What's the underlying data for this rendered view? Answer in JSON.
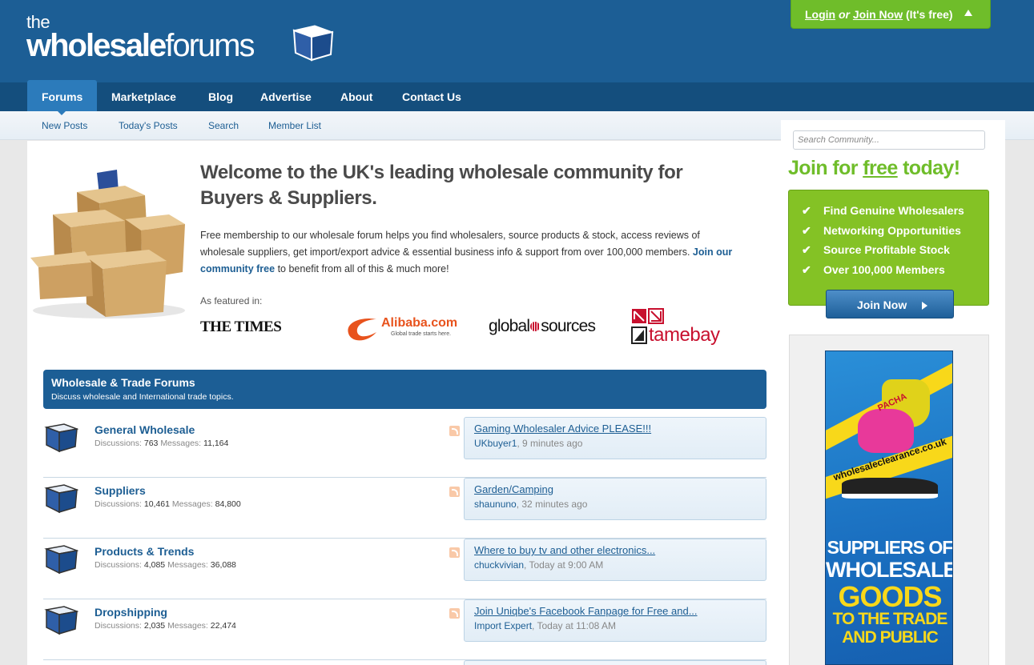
{
  "header": {
    "logo": {
      "the": "the",
      "bold": "wholesale",
      "light": "forums"
    },
    "login": {
      "login": "Login",
      "or": "or",
      "join": "Join Now",
      "free": "(It's free)"
    }
  },
  "nav": {
    "tabs": [
      {
        "label": "Forums",
        "active": true
      },
      {
        "label": "Marketplace"
      },
      {
        "label": "Blog"
      },
      {
        "label": "Advertise"
      },
      {
        "label": "About"
      },
      {
        "label": "Contact Us"
      }
    ],
    "subnav": [
      "New Posts",
      "Today's Posts",
      "Search",
      "Member List"
    ]
  },
  "search": {
    "placeholder": "Search Community..."
  },
  "welcome": {
    "heading": "Welcome to the UK's leading wholesale community for Buyers & Suppliers.",
    "intro": "Free membership to our wholesale forum helps you find wholesalers, source products & stock, access reviews of wholesale suppliers, get import/export advice & essential business info & support from over 100,000 members.",
    "join_link": "Join our community free",
    "intro_end": "to benefit from all of this & much more!",
    "featured_label": "As featured in:",
    "media": {
      "times": "THE TIMES",
      "alibaba": "Alibaba.com",
      "alibaba_tag": "Global trade starts here.",
      "global_a": "global",
      "global_b": "sources",
      "tamebay": "tamebay"
    }
  },
  "forum_section": {
    "title": "Wholesale & Trade Forums",
    "description": "Discuss wholesale and International trade topics.",
    "discussions_label": "Discussions:",
    "messages_label": "Messages:",
    "forums": [
      {
        "name": "General Wholesale",
        "discussions": "763",
        "messages": "11,164",
        "last_thread": "Gaming Wholesaler Advice PLEASE!!!",
        "last_user": "UKbuyer1",
        "last_time": ", 9 minutes ago"
      },
      {
        "name": "Suppliers",
        "discussions": "10,461",
        "messages": "84,800",
        "last_thread": "Garden/Camping",
        "last_user": "shaununo",
        "last_time": ", 32 minutes ago"
      },
      {
        "name": "Products & Trends",
        "discussions": "4,085",
        "messages": "36,088",
        "last_thread": "Where to buy tv and other electronics...",
        "last_user": "chuckvivian",
        "last_time": ", Today at 9:00 AM"
      },
      {
        "name": "Dropshipping",
        "discussions": "2,035",
        "messages": "22,474",
        "last_thread": "Join Uniqbe's Facebook Fanpage for Free and...",
        "last_user": "Import Expert",
        "last_time": ", Today at 11:08 AM"
      }
    ]
  },
  "join_box": {
    "title_a": "Join for",
    "title_free": "free",
    "title_b": "today!",
    "benefits": [
      "Find Genuine Wholesalers",
      "Networking Opportunities",
      "Source Profitable Stock",
      "Over 100,000 Members"
    ],
    "button": "Join Now"
  },
  "ad": {
    "url": "wholesaleclearance.co.uk",
    "brand": "PACHA",
    "line1": "SUPPLIERS OF",
    "line2": "WHOLESALE",
    "line3": "GOODS",
    "line4": "TO THE TRADE",
    "line5": "AND PUBLIC"
  },
  "colors": {
    "brand_blue": "#1c5e95",
    "nav_dark": "#144e7d",
    "accent_green": "#6fbd2a",
    "panel_green": "#84c225",
    "link": "#1d5e93"
  }
}
